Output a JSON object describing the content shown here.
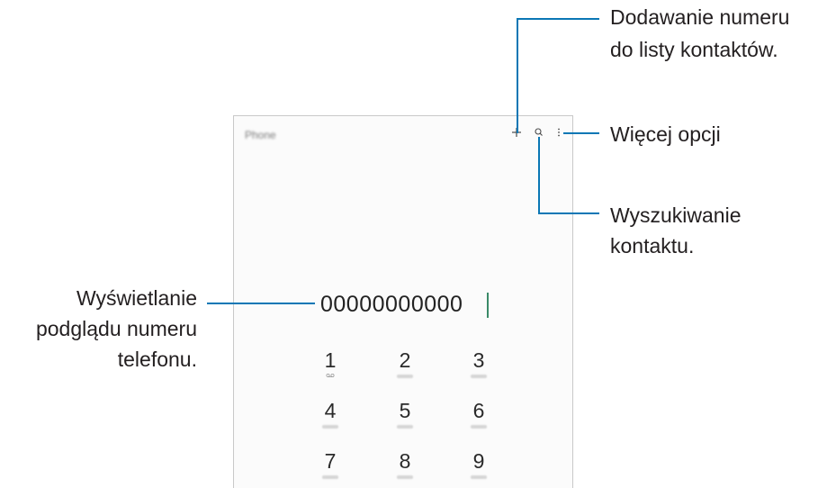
{
  "annotations": {
    "add_contact": {
      "line1": "Dodawanie numeru",
      "line2": "do listy kontaktów."
    },
    "more_options": "Więcej opcji",
    "search_contact": {
      "line1": "Wyszukiwanie",
      "line2": "kontaktu."
    },
    "preview_number": {
      "line1": "Wyświetlanie",
      "line2": "podglądu numeru",
      "line3": "telefonu."
    }
  },
  "phone": {
    "app_title": "Phone",
    "icons": {
      "add": "plus-icon",
      "search": "search-icon",
      "more": "more-vertical-icon"
    },
    "entered_number": "00000000000",
    "keypad": [
      {
        "digit": "1",
        "sub": "voicemail"
      },
      {
        "digit": "2",
        "sub": ""
      },
      {
        "digit": "3",
        "sub": ""
      },
      {
        "digit": "4",
        "sub": ""
      },
      {
        "digit": "5",
        "sub": ""
      },
      {
        "digit": "6",
        "sub": ""
      },
      {
        "digit": "7",
        "sub": ""
      },
      {
        "digit": "8",
        "sub": ""
      },
      {
        "digit": "9",
        "sub": ""
      }
    ]
  },
  "colors": {
    "callout_line": "#0a77b5",
    "caret": "#3a8a68",
    "text": "#231f20"
  }
}
